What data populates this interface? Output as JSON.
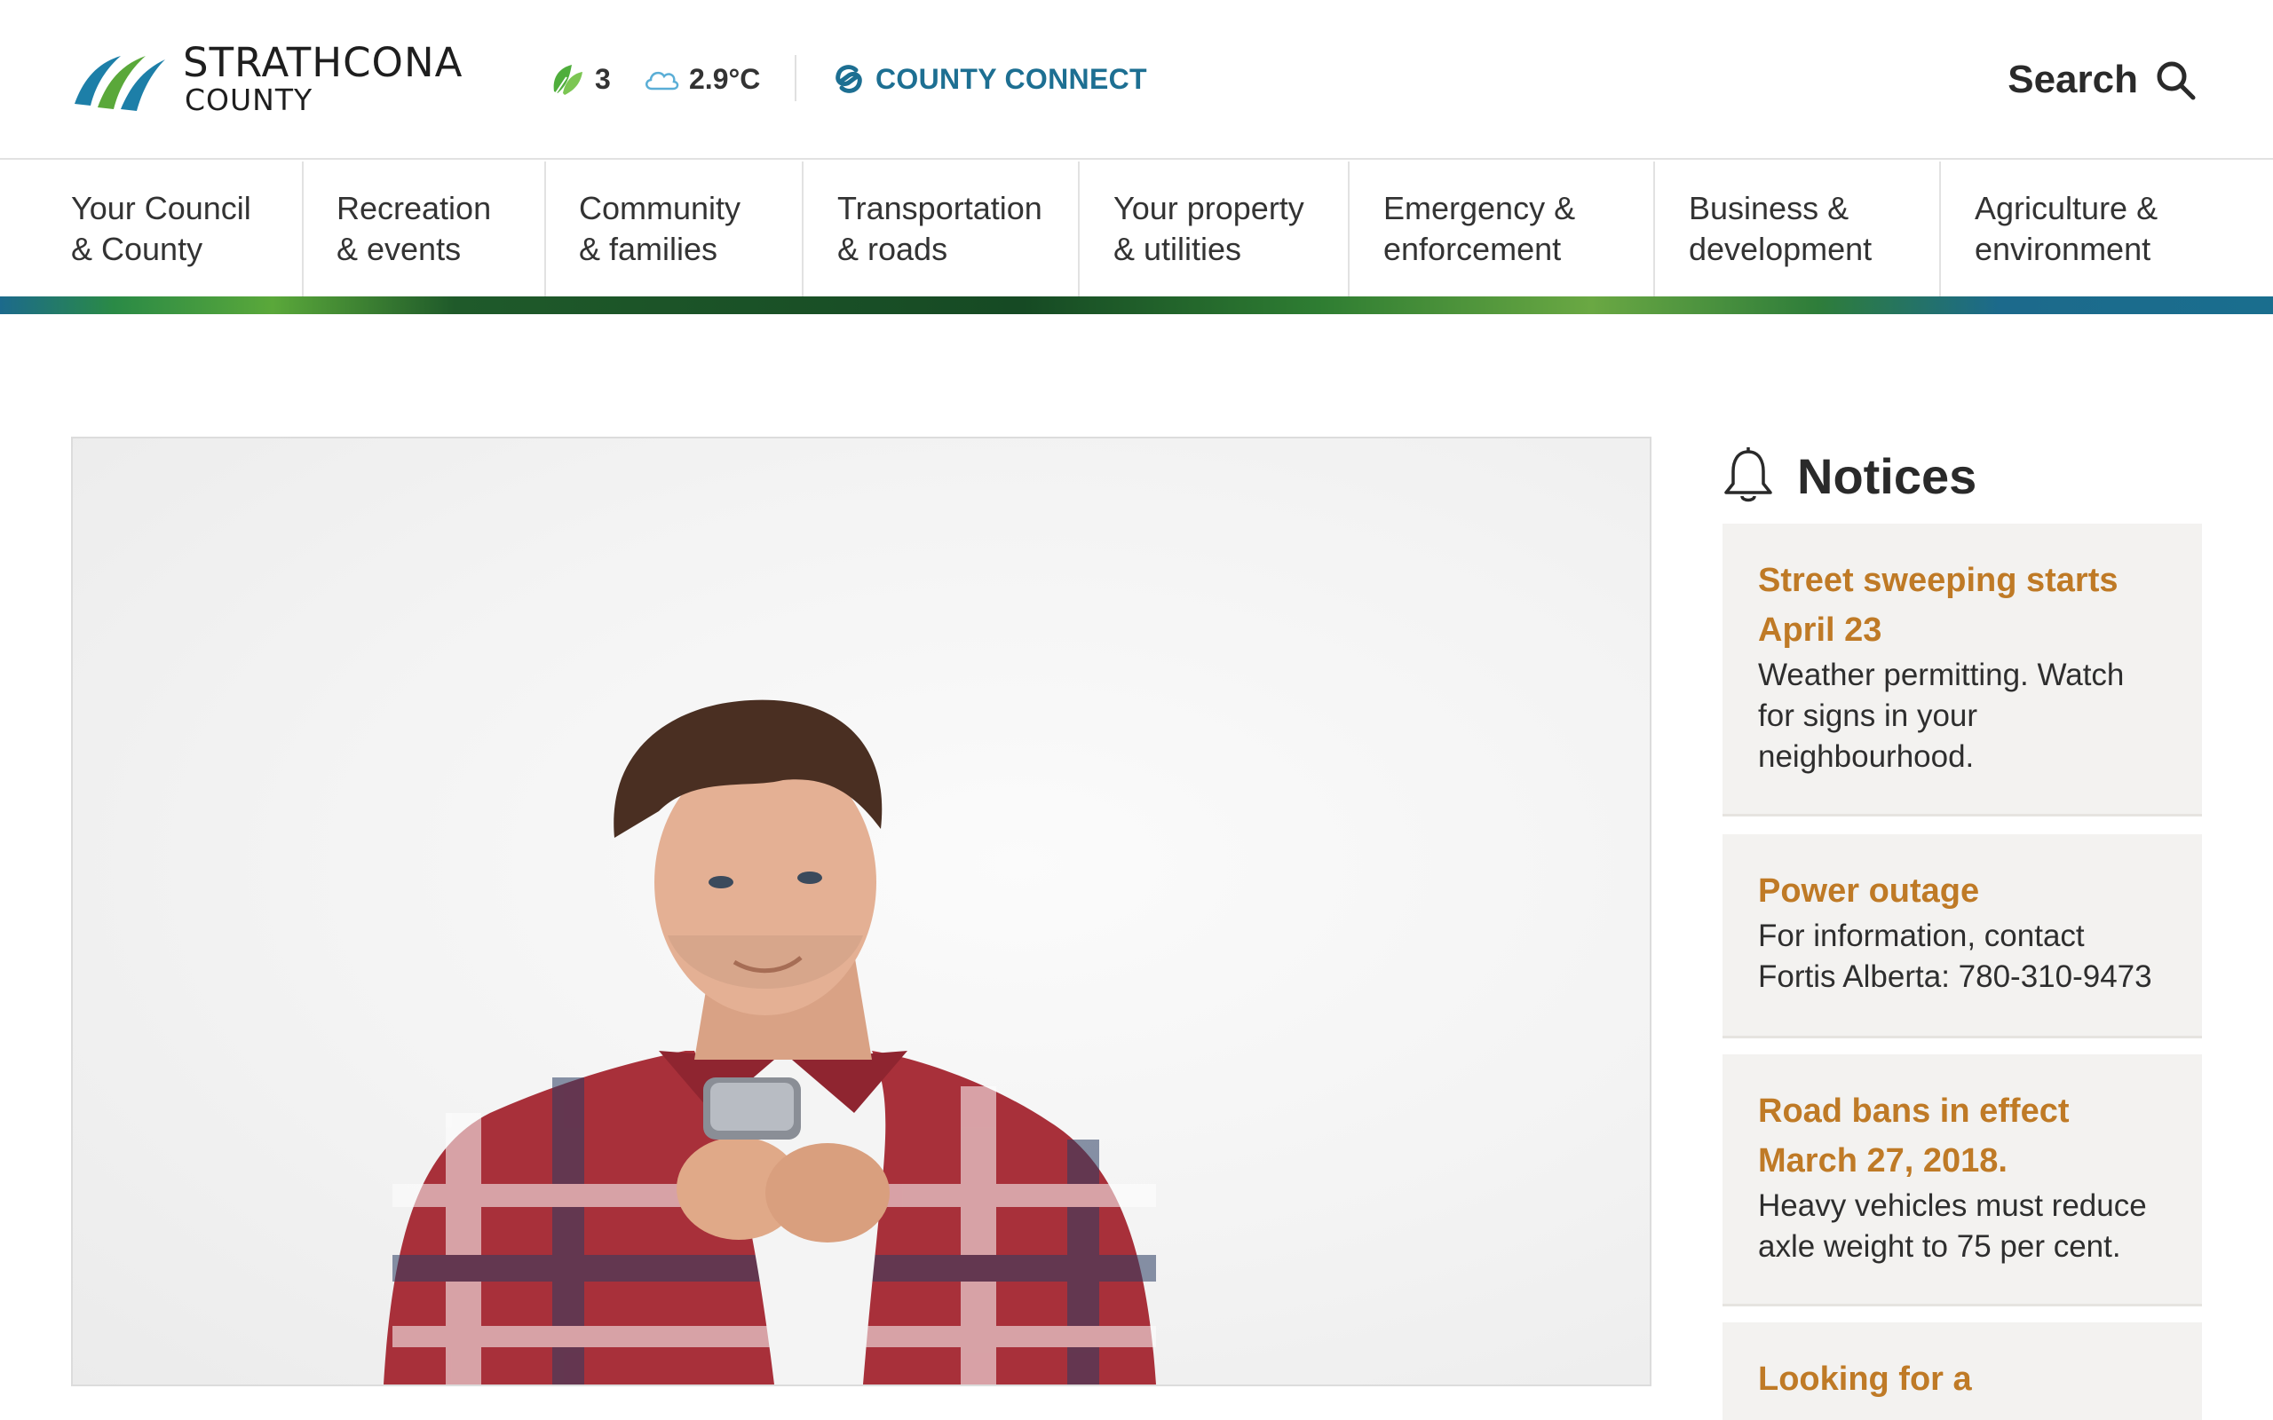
{
  "header": {
    "logo_line1": "STRATHCONA",
    "logo_line2": "COUNTY",
    "air_quality": "3",
    "temperature": "2.9°C",
    "county_connect": "COUNTY CONNECT",
    "search_label": "Search"
  },
  "nav": [
    {
      "line1": "Your Council",
      "line2": "& County"
    },
    {
      "line1": "Recreation",
      "line2": "& events"
    },
    {
      "line1": "Community",
      "line2": "& families"
    },
    {
      "line1": "Transportation",
      "line2": "& roads"
    },
    {
      "line1": "Your property",
      "line2": "& utilities"
    },
    {
      "line1": "Emergency &",
      "line2": "enforcement"
    },
    {
      "line1": "Business &",
      "line2": "development"
    },
    {
      "line1": "Agriculture &",
      "line2": "environment"
    }
  ],
  "notices": {
    "heading": "Notices",
    "items": [
      {
        "title": "Street sweeping starts April 23",
        "body": "Weather permitting. Watch for signs in your neighbourhood."
      },
      {
        "title": "Power outage",
        "body": "For information, contact Fortis Alberta: 780-310-9473"
      },
      {
        "title": "Road bans in effect March 27, 2018.",
        "body": "Heavy vehicles must reduce axle weight to 75 per cent."
      },
      {
        "title": "Looking for a",
        "body": ""
      }
    ]
  },
  "colors": {
    "accent_orange": "#bf7a26",
    "brand_blue": "#1d6f92",
    "brand_green": "#5aa83a",
    "notice_bg": "#f3f2f0"
  },
  "icons": {
    "logo": "strathcona-swoosh-logo",
    "air_quality": "leaf-icon",
    "weather": "cloud-icon",
    "county_connect": "county-connect-icon",
    "search": "search-icon",
    "notices": "bell-icon"
  }
}
